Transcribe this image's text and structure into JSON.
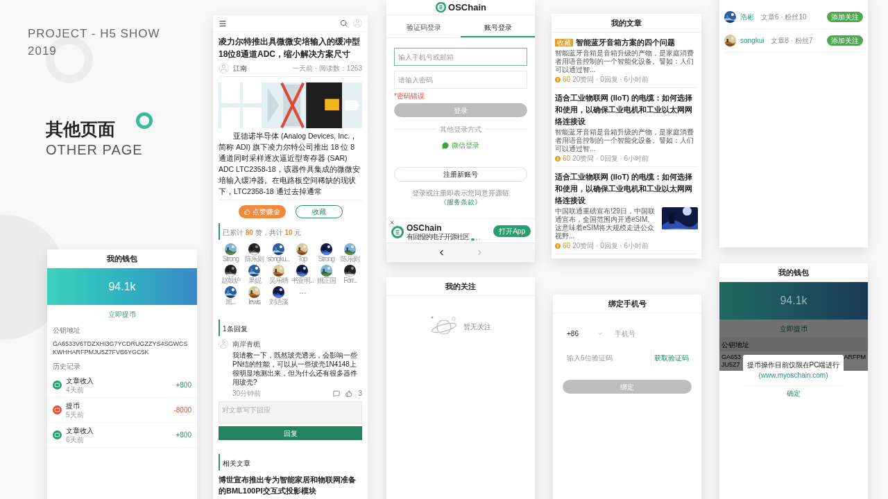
{
  "intro": {
    "project": "PROJECT - H5 SHOW",
    "year": "2019",
    "title": "其他页面",
    "subtitle": "OTHER PAGE"
  },
  "wallet": {
    "title": "我的钱包",
    "balance": "94.1k",
    "withdraw": "立即提币",
    "key_label": "公钥地址",
    "key": "GA6533V6TDZXHI3G7YCDRUGZZYS4SGWCSKWHHARFPMJU5Z7FVB6YGC5K",
    "history_label": "历史记录",
    "records": [
      {
        "kind": "income",
        "title": "文章收入",
        "time": "4天前",
        "amount": "+800"
      },
      {
        "kind": "withdraw",
        "title": "提币",
        "time": "5天前",
        "amount": "-8000"
      },
      {
        "kind": "income",
        "title": "文章收入",
        "time": "6天前",
        "amount": "+800"
      }
    ]
  },
  "article": {
    "title": "凌力尔特推出具微微安培输入的缓冲型18位8通道ADC，缩小解决方案尺寸",
    "author": "江南",
    "meta": "一天前 · 阅读数：1263",
    "body": "亚德诺半导体 (Analog Devices, Inc.，简称 ADI) 旗下凌力尔特公司推出 18 位 8 通道同时采样逐次逼近型寄存器 (SAR) ADC LTC2358-18，该器件具集成的微微安培输入缓冲器。在电路板空间稀缺的现状下，LTC2358-18 通过去掉通常",
    "like_button": "点赞赚金",
    "save_button": "收藏",
    "tally": "已累计 **80** 赞，共计 **10** 元",
    "likers": [
      {
        "name": "Strong"
      },
      {
        "name": "陈乐则"
      },
      {
        "name": "songku..."
      },
      {
        "name": "Top"
      },
      {
        "name": "Strong"
      },
      {
        "name": "陈乐则"
      },
      {
        "name": "赵鼓炉"
      },
      {
        "name": "果妮"
      },
      {
        "name": "吴乐晴"
      },
      {
        "name": "书亚明..."
      },
      {
        "name": "姚正国"
      },
      {
        "name": "Forr..."
      },
      {
        "name": "黑..."
      },
      {
        "name": "lewis"
      },
      {
        "name": "刘语溪"
      }
    ],
    "comments_title": "1条回复",
    "comments": [
      {
        "name": "南岸青栀",
        "text": "我请教一下，既然玻壳透光，会影响一些PN结的性能，可以从一些玻壳1N4148上很明显地测出来，但为什么还有很多器件用玻壳?",
        "time": "30分钟前",
        "likes": "3"
      }
    ],
    "reply_placeholder": "对文章写下回应",
    "reply_button": "回复",
    "related_title": "相关文章",
    "related": [
      "博世宣布推出专为智能家居和物联网准备的BML100PI交互式投影模块"
    ]
  },
  "login": {
    "brand": "OSChain",
    "tabs": [
      {
        "label": "验证码登录",
        "selected": false
      },
      {
        "label": "账号登录",
        "selected": true
      }
    ],
    "account_placeholder": "输入手机号或邮箱",
    "password_placeholder": "请输入密码",
    "error": "*密码错误",
    "login_button": {
      "label": "登录",
      "disabled": true
    },
    "other_label": "其他登录方式",
    "wechat": "微信登录",
    "register": "注册新账号",
    "terms": "登录或注册即表示您同意开源链",
    "terms_link": "《服务条款》",
    "banner": {
      "brand": "OSChain",
      "slogan": "有回报的电子开源社区",
      "button": "打开App"
    },
    "nav": {
      "back_disabled": false,
      "forward_disabled": true
    }
  },
  "follow_empty": {
    "title": "我的关注",
    "message": "暂无关注"
  },
  "my_articles": {
    "title": "我的文章",
    "items": [
      {
        "kind": "text",
        "tag": "收藏",
        "title": "智能蓝牙音箱方案的四个问题",
        "excerpt": "智能蓝牙音箱是音箱升级的产物，是家庭消费者用语音控制的一个智能化设备。譬如：人们可以通过智...",
        "coins": "60",
        "stats": "20赞同 · 0回复 · 6小时前"
      },
      {
        "kind": "text",
        "title": "适合工业物联网 (IIoT) 的电缆：如何选择和使用，以确保工业电机和工业以太网网络连接设",
        "excerpt": "智能蓝牙音箱是音箱升级的产物，是家庭消费者用语音控制的一个智能化设备。譬如：人们可以通过智...",
        "coins": "60",
        "stats": "20赞同 · 0回复 · 6小时前"
      },
      {
        "kind": "picture",
        "title": "适合工业物联网 (IIoT) 的电缆：如何选择和使用，以确保工业电机和工业以太网网络连接设",
        "excerpt": "中国联通重磅宣布!29日，中国联通宣布，全国范围内开通eSIM。这意味着eSIM将大规模走进公众视野...",
        "coins": "60",
        "stats": "20赞同 · 0回复 · 6小时前"
      }
    ]
  },
  "bind_phone": {
    "title": "绑定手机号",
    "country_code": "+86",
    "phone_placeholder": "手机号",
    "code_placeholder": "输入6位验证码",
    "code_button": "获取验证码",
    "bind_button": {
      "label": "绑定",
      "disabled": true
    }
  },
  "follow_list": {
    "users": [
      {
        "name": "浩彬",
        "stats": "文章6 · 粉丝10",
        "button": "添加关注"
      },
      {
        "name": "songkui",
        "stats": "文章8 · 粉丝7",
        "button": "添加关注"
      }
    ]
  },
  "wallet_dialog": {
    "title": "我的钱包",
    "balance": "94.1k",
    "withdraw": "立即提币",
    "key_label": "公钥地址",
    "key_left": [
      "GA653",
      "JU5Z7"
    ],
    "key_right": "ARFPM",
    "dialog": {
      "message": "提币操作目前仅限在PC端进行",
      "link": "(www.myoschain.com)",
      "confirm": "确定"
    }
  }
}
